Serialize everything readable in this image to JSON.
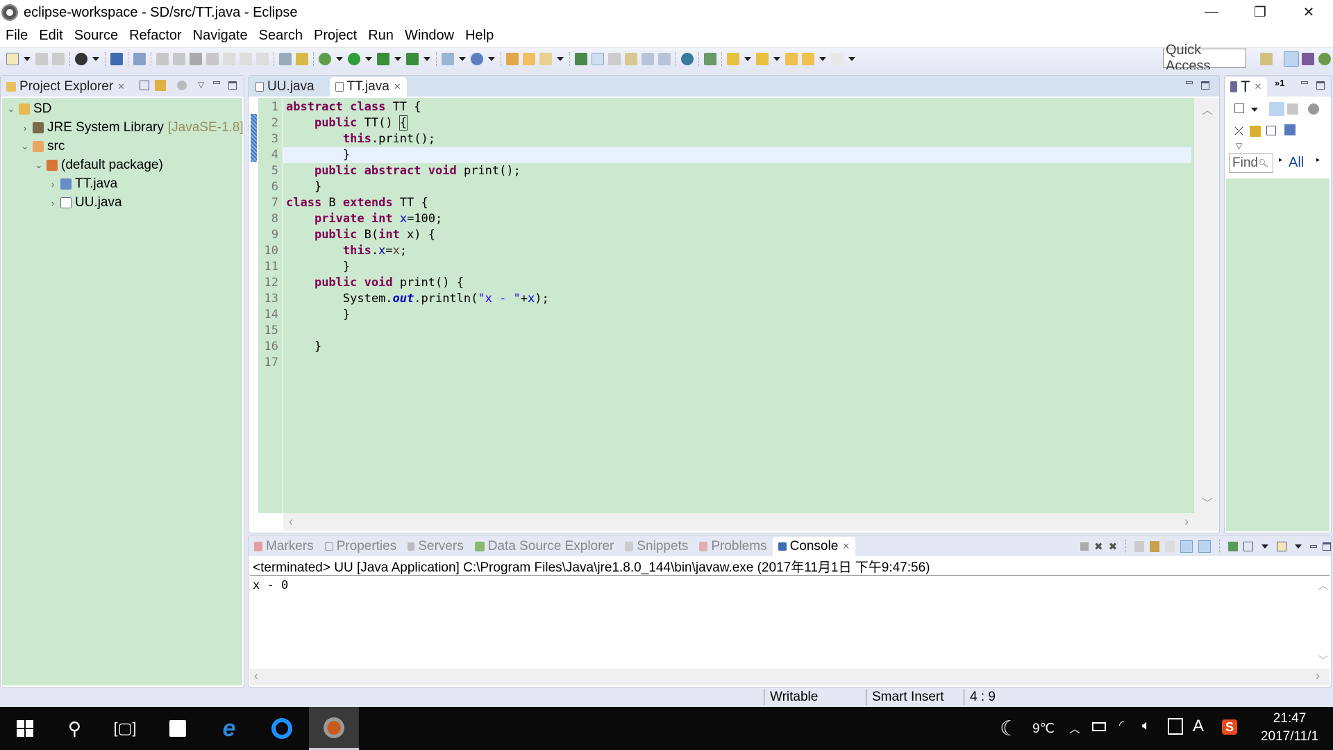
{
  "window": {
    "title": "eclipse-workspace - SD/src/TT.java - Eclipse",
    "controls": {
      "minimize": "—",
      "restore": "❐",
      "close": "✕"
    }
  },
  "menu": [
    "File",
    "Edit",
    "Source",
    "Refactor",
    "Navigate",
    "Search",
    "Project",
    "Run",
    "Window",
    "Help"
  ],
  "toolbar": {
    "quick_access": "Quick Access"
  },
  "explorer": {
    "tab_label": "Project Explorer",
    "tree": [
      {
        "label": "SD",
        "level": 0,
        "expanded": true,
        "icon": "project-icon"
      },
      {
        "label": "JRE System Library",
        "suffix": "[JavaSE-1.8]",
        "level": 1,
        "expanded": false,
        "icon": "library-icon"
      },
      {
        "label": "src",
        "level": 1,
        "expanded": true,
        "icon": "source-folder-icon"
      },
      {
        "label": "(default package)",
        "level": 2,
        "expanded": true,
        "icon": "package-icon"
      },
      {
        "label": "TT.java",
        "level": 3,
        "expanded": false,
        "icon": "java-file-icon"
      },
      {
        "label": "UU.java",
        "level": 3,
        "expanded": false,
        "icon": "java-file-icon"
      }
    ]
  },
  "editor": {
    "tabs": [
      {
        "label": "UU.java",
        "active": false
      },
      {
        "label": "TT.java",
        "active": true
      }
    ],
    "current_line": 4,
    "lines": [
      "abstract class TT {",
      "    public TT() {",
      "        this.print();",
      "        }",
      "    public abstract void print();",
      "    }",
      "class B extends TT {",
      "    private int x=100;",
      "    public B(int x) {",
      "        this.x=x;",
      "        }",
      "    public void print() {",
      "        System.out.println(\"x - \"+x);",
      "        }",
      "",
      "    }",
      ""
    ]
  },
  "outline": {
    "tab_label": "T",
    "overflow": "»1",
    "find_placeholder": "Find",
    "all_label": "All"
  },
  "bottom": {
    "tabs": [
      "Markers",
      "Properties",
      "Servers",
      "Data Source Explorer",
      "Snippets",
      "Problems",
      "Console"
    ],
    "active_tab": "Console",
    "console_header": "<terminated> UU [Java Application] C:\\Program Files\\Java\\jre1.8.0_144\\bin\\javaw.exe (2017年11月1日 下午9:47:56)",
    "output": "x - 0"
  },
  "status": {
    "writable": "Writable",
    "insert_mode": "Smart Insert",
    "position": "4 : 9"
  },
  "taskbar": {
    "weather_temp": "9℃",
    "time": "21:47",
    "date": "2017/11/1",
    "ime": "A"
  },
  "colors": {
    "editor_bg": "#cce8cf",
    "keyword": "#7f0055",
    "field": "#0000c0",
    "string": "#2a00ff",
    "current_line": "#e8f2fe"
  }
}
